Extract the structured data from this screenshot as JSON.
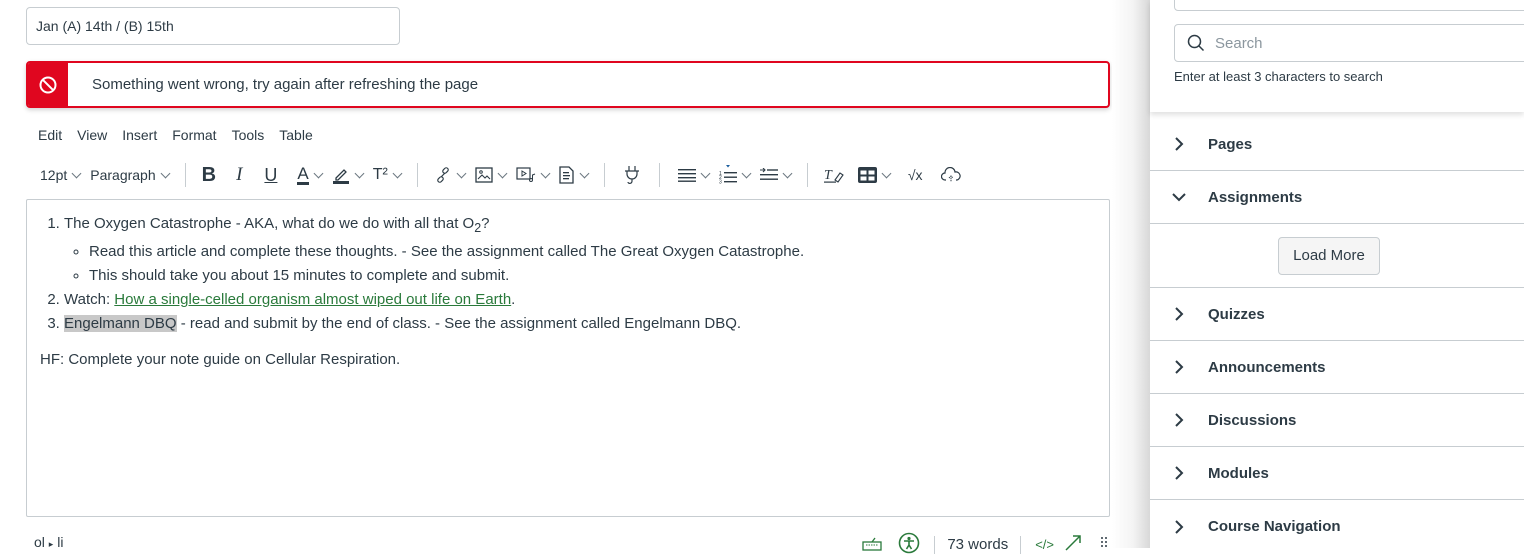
{
  "title_field": {
    "value": "Jan (A) 14th / (B) 15th"
  },
  "alert": {
    "message": "Something went wrong, try again after refreshing the page",
    "icon": "no-entry-icon",
    "color": "#e0061f"
  },
  "menubar": {
    "items": [
      "Edit",
      "View",
      "Insert",
      "Format",
      "Tools",
      "Table"
    ]
  },
  "toolbar": {
    "font_size": "12pt",
    "block_format": "Paragraph",
    "icons": [
      "bold-icon",
      "italic-icon",
      "underline-icon",
      "text-color-icon",
      "highlight-icon",
      "superscript-icon",
      "link-icon",
      "image-icon",
      "media-icon",
      "document-icon",
      "plugin-icon",
      "align-icon",
      "ordered-list-icon",
      "indent-icon",
      "clear-formatting-icon",
      "table-icon",
      "equation-icon",
      "cloud-upload-icon"
    ],
    "bold_glyph": "B",
    "italic_glyph": "I",
    "underline_glyph": "U",
    "text_color_glyph": "A",
    "superscript_glyph": "T²",
    "equation_glyph": "√x"
  },
  "editor": {
    "item1_text": "The Oxygen Catastrophe - AKA, what do we do with all that O",
    "item1_sub": "2",
    "item1_end": "?",
    "item1_bullets": [
      "Read this article and complete these thoughts. - See the assignment called The Great Oxygen Catastrophe.",
      "This should take you about 15 minutes to complete and submit."
    ],
    "item2_prefix": "Watch: ",
    "item2_link": "How a single-celled organism almost wiped out life on Earth",
    "item2_suffix": ".",
    "item3_highlight": "Engelmann DBQ",
    "item3_text": " - read and submit by the end of class. - See the assignment called Engelmann DBQ.",
    "paragraph": "HF: Complete your note guide on Cellular Respiration.",
    "link_color": "#2a7a3b"
  },
  "statusbar": {
    "path_ol": "ol",
    "path_sep": "▸",
    "path_li": "li",
    "word_count": "73 words",
    "html_toggle": "</>"
  },
  "sidebar": {
    "search_placeholder": "Search",
    "search_hint": "Enter at least 3 characters to search",
    "sections": [
      {
        "label": "Pages",
        "expanded": false
      },
      {
        "label": "Assignments",
        "expanded": true
      },
      {
        "label": "Quizzes",
        "expanded": false
      },
      {
        "label": "Announcements",
        "expanded": false
      },
      {
        "label": "Discussions",
        "expanded": false
      },
      {
        "label": "Modules",
        "expanded": false
      },
      {
        "label": "Course Navigation",
        "expanded": false
      }
    ],
    "load_more_label": "Load More"
  }
}
